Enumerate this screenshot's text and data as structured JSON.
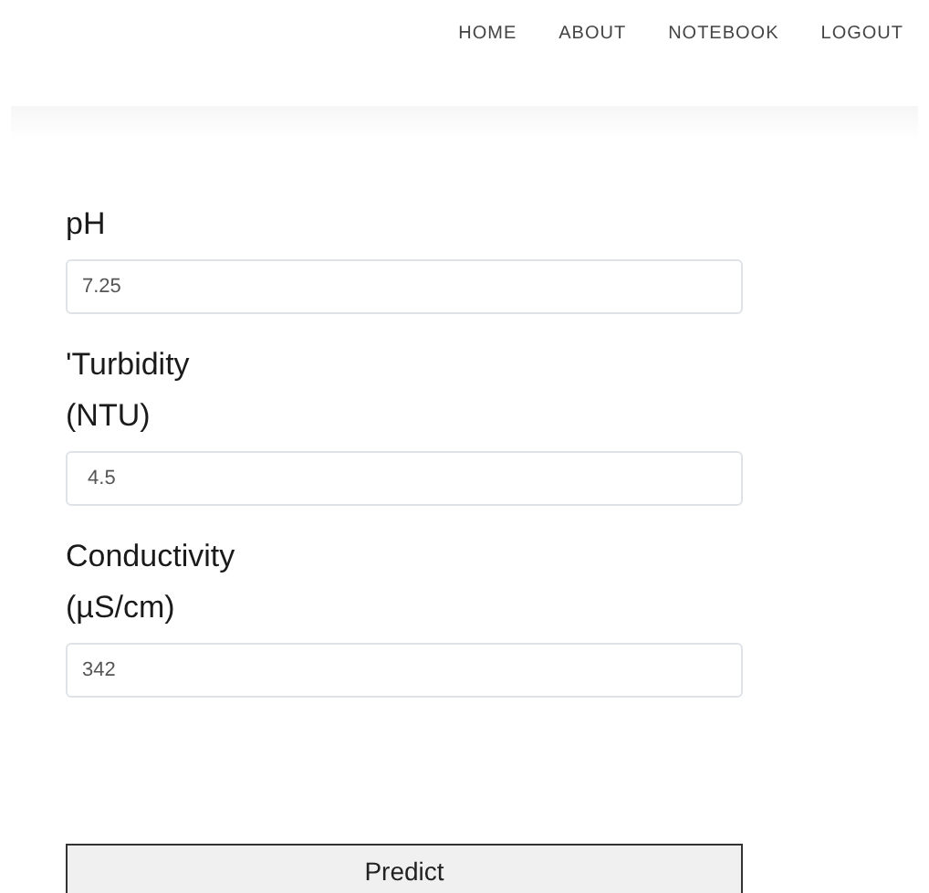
{
  "nav": [
    {
      "label": "HOME"
    },
    {
      "label": "ABOUT"
    },
    {
      "label": "NOTEBOOK"
    },
    {
      "label": "LOGOUT"
    }
  ],
  "fields": [
    {
      "label": "pH",
      "value": "7.25"
    },
    {
      "label": "'Turbidity (NTU)",
      "value": " 4.5"
    },
    {
      "label": "Conductivity (µS/cm)",
      "value": "342"
    }
  ],
  "button": "Predict"
}
